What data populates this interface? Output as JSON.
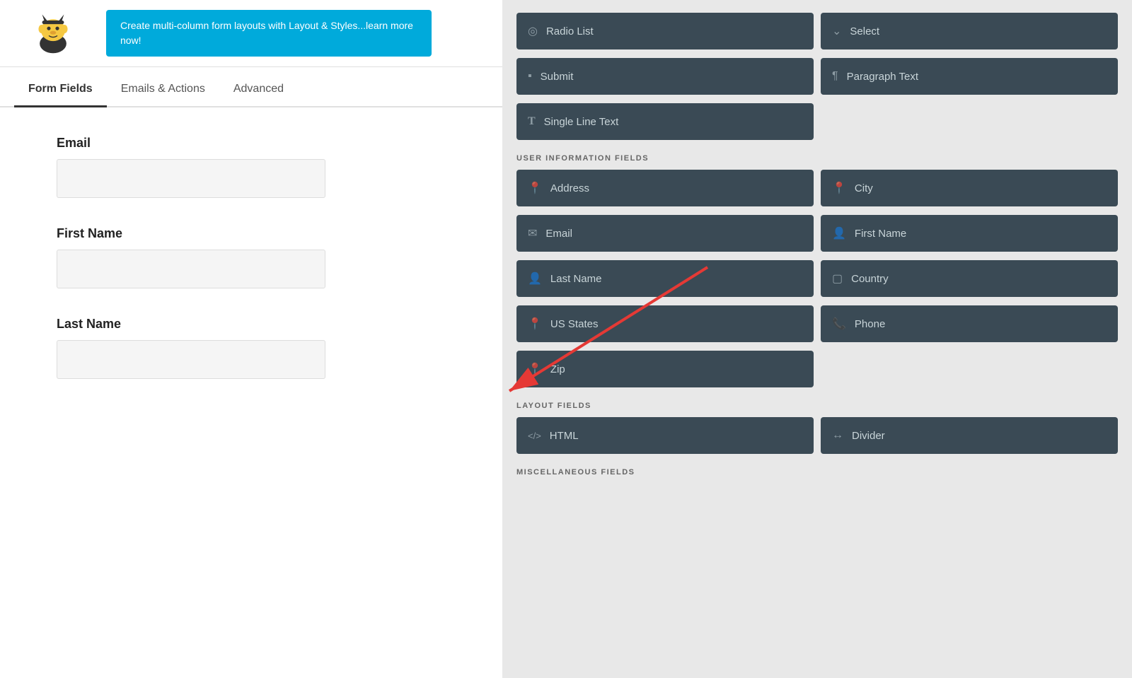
{
  "promo": {
    "text": "Create multi-column form layouts with Layout & Styles...learn more now!"
  },
  "tabs": [
    {
      "id": "form-fields",
      "label": "Form Fields",
      "active": true
    },
    {
      "id": "emails-actions",
      "label": "Emails & Actions",
      "active": false
    },
    {
      "id": "advanced",
      "label": "Advanced",
      "active": false
    }
  ],
  "form": {
    "fields": [
      {
        "id": "email",
        "label": "Email"
      },
      {
        "id": "first-name",
        "label": "First Name"
      },
      {
        "id": "last-name",
        "label": "Last Name"
      }
    ]
  },
  "right_panel": {
    "standard_section": {
      "buttons_row1": [
        {
          "id": "radio-list",
          "icon": "◎",
          "label": "Radio List"
        },
        {
          "id": "select",
          "icon": "⌄",
          "label": "Select"
        }
      ],
      "buttons_row2": [
        {
          "id": "submit",
          "icon": "▪",
          "label": "Submit"
        },
        {
          "id": "paragraph-text",
          "icon": "¶",
          "label": "Paragraph Text"
        }
      ],
      "buttons_row3": [
        {
          "id": "single-line-text",
          "icon": "T",
          "label": "Single Line Text"
        }
      ]
    },
    "user_info": {
      "title": "USER INFORMATION FIELDS",
      "buttons_row1": [
        {
          "id": "address",
          "icon": "📍",
          "label": "Address"
        },
        {
          "id": "city",
          "icon": "📍",
          "label": "City"
        }
      ],
      "buttons_row2": [
        {
          "id": "email-field",
          "icon": "✉",
          "label": "Email"
        },
        {
          "id": "first-name-field",
          "icon": "👤",
          "label": "First Name"
        }
      ],
      "buttons_row3": [
        {
          "id": "last-name-field",
          "icon": "👤",
          "label": "Last Name"
        },
        {
          "id": "country",
          "icon": "▢",
          "label": "Country"
        }
      ],
      "buttons_row4": [
        {
          "id": "us-states",
          "icon": "📍",
          "label": "US States"
        },
        {
          "id": "phone",
          "icon": "📞",
          "label": "Phone"
        }
      ],
      "buttons_row5": [
        {
          "id": "zip",
          "icon": "📍",
          "label": "Zip"
        }
      ]
    },
    "layout": {
      "title": "LAYOUT FIELDS",
      "buttons_row1": [
        {
          "id": "html",
          "icon": "</>",
          "label": "HTML"
        },
        {
          "id": "divider",
          "icon": "↔",
          "label": "Divider"
        }
      ]
    },
    "misc": {
      "title": "MISCELLANEOUS FIELDS"
    }
  }
}
